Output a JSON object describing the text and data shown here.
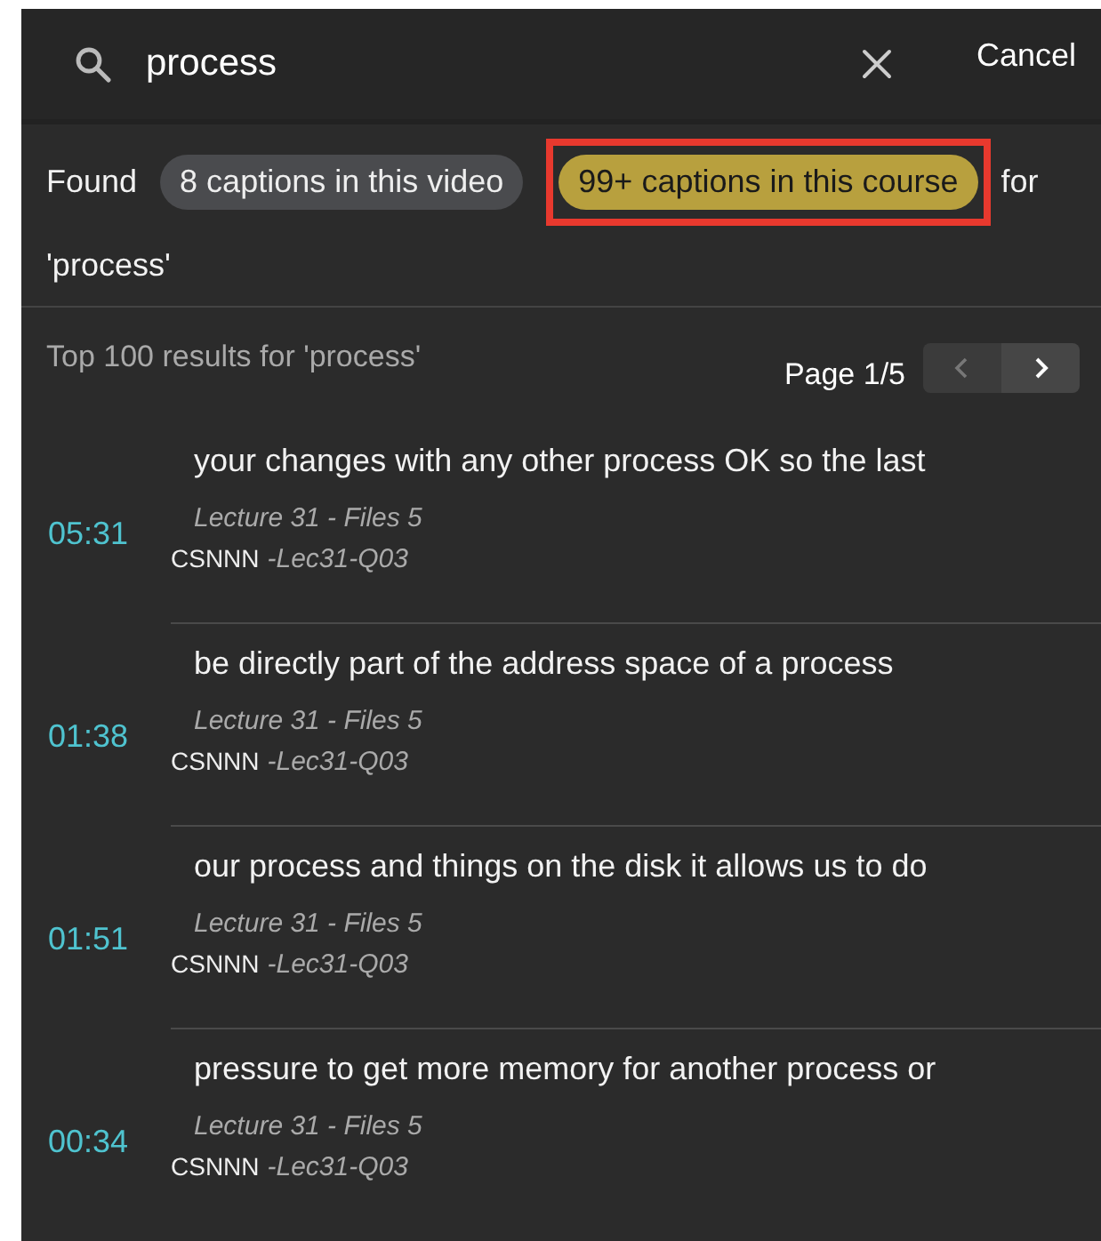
{
  "search": {
    "value": "process",
    "cancel": "Cancel"
  },
  "found": {
    "prefix": "Found",
    "suffix": "for",
    "query": "'process'",
    "chips": [
      {
        "label": "8 captions in this video",
        "selected": false,
        "highlighted": false
      },
      {
        "label": "99+ captions in this course",
        "selected": true,
        "highlighted": true
      }
    ]
  },
  "results_header": {
    "title": "Top 100 results for 'process'",
    "page": "Page 1/5",
    "prev_disabled": true,
    "next_disabled": false
  },
  "results": [
    {
      "time": "05:31",
      "text": "your changes with any other process OK so the last",
      "lecture": "Lecture 31 - Files 5",
      "course": "CSNNN",
      "code": "-Lec31-Q03"
    },
    {
      "time": "01:38",
      "text": "be directly part of the address space of a process",
      "lecture": "Lecture 31 - Files 5",
      "course": "CSNNN",
      "code": "-Lec31-Q03"
    },
    {
      "time": "01:51",
      "text": "our process and things on the disk it allows us to do",
      "lecture": "Lecture 31 - Files 5",
      "course": "CSNNN",
      "code": "-Lec31-Q03"
    },
    {
      "time": "00:34",
      "text": "pressure to get more memory for another process or",
      "lecture": "Lecture 31 - Files 5",
      "course": "CSNNN",
      "code": "-Lec31-Q03"
    }
  ]
}
